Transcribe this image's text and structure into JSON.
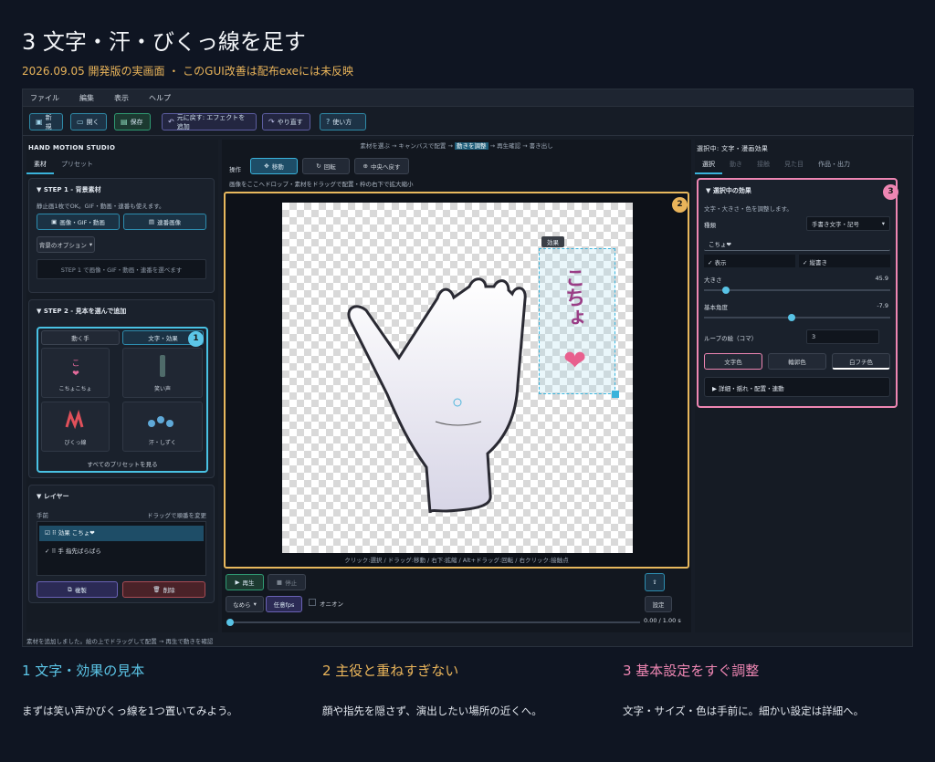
{
  "header": {
    "title": "3 文字・汗・びくっ線を足す",
    "subtitle": "2026.09.05 開発版の実画面 ・ このGUI改善は配布exeには未反映"
  },
  "menu": [
    "ファイル",
    "編集",
    "表示",
    "ヘルプ"
  ],
  "toolbar": {
    "new": "新規",
    "open": "開く",
    "save": "保存",
    "undo": "元に戻す: エフェクトを追加",
    "redo": "やり直す",
    "howto": "使い方"
  },
  "left": {
    "app_title": "HAND MOTION STUDIO",
    "tabs": [
      "素材",
      "プリセット"
    ],
    "step1": {
      "title": "STEP 1 - 背景素材",
      "hint": "静止画1枚でOK。GIF・動画・連番も使えます。",
      "btn_media": "画像・GIF・動画",
      "btn_seq": "連番画像",
      "btn_options": "背景のオプション",
      "placeholder": "STEP 1 で画像・GIF・動画・連番を選べます"
    },
    "step2": {
      "title": "STEP 2 - 見本を選んで追加",
      "tab_hand": "動く手",
      "tab_text": "文字・効果",
      "tiles": [
        "こちょこちょ",
        "笑い声",
        "びくっ線",
        "汗・しずく"
      ],
      "all": "すべてのプリセットを見る"
    },
    "layers": {
      "title": "レイヤー",
      "front": "手前",
      "drag_hint": "ドラッグで順番を変更",
      "items": [
        "効果 こちょ❤",
        "手 指先ばらばら"
      ],
      "copy": "複製",
      "delete": "削除"
    }
  },
  "center": {
    "steps": "素材を選ぶ → キャンバスで配置 → 動きを調整 → 再生確認 → 書き出し",
    "steps_hl": "動きを調整",
    "op_label": "操作",
    "move": "移動",
    "rotate": "回転",
    "center_btn": "中央へ戻す",
    "hint": "画像をここへドロップ・素材をドラッグで配置・枠の右下で拡大縮小",
    "effect_tag": "効果",
    "effect_text": "こちょ",
    "bottom_hint": "クリック:選択 / ドラッグ:移動 / 右下:拡縮 / Alt+ドラッグ:回転 / 右クリック:接触点",
    "play": "再生",
    "stop": "停止",
    "ease": "なめら",
    "fps": "任意fps",
    "onion": "オニオン",
    "settings": "設定",
    "time": "0.00 / 1.00 s"
  },
  "right": {
    "title": "選択中: 文字・漫画効果",
    "tabs": [
      "選択",
      "動き",
      "接触",
      "見た目",
      "作品・出力"
    ],
    "section": "選択中の効果",
    "desc": "文字・大きさ・色を調整します。",
    "kind_label": "種類",
    "kind_value": "手書き文字・記号",
    "text_value": "こちょ❤",
    "show": "表示",
    "vertical": "縦書き",
    "size_label": "大きさ",
    "size_value": "45.9",
    "size_frac": 0.12,
    "angle_label": "基本角度",
    "angle_value": "-7.9",
    "angle_frac": 0.47,
    "loop_label": "ループの絵（コマ）",
    "loop_value": "3",
    "color_text": "文字色",
    "color_outline": "輪郭色",
    "color_white": "白フチ色",
    "details": "詳細・揺れ・配置・連動"
  },
  "status": "素材を追加しました。絵の上でドラッグして配置 → 再生で動きを確認",
  "badges": [
    "1",
    "2",
    "3"
  ],
  "captions": [
    {
      "title": "1 文字・効果の見本",
      "text": "まずは笑い声かびくっ線を1つ置いてみよう。",
      "color": "#5cc6e8"
    },
    {
      "title": "2 主役と重ねすぎない",
      "text": "顔や指先を隠さず、演出したい場所の近くへ。",
      "color": "#e9b45a"
    },
    {
      "title": "3 基本設定をすぐ調整",
      "text": "文字・サイズ・色は手前に。細かい設定は詳細へ。",
      "color": "#ee86b3"
    }
  ]
}
